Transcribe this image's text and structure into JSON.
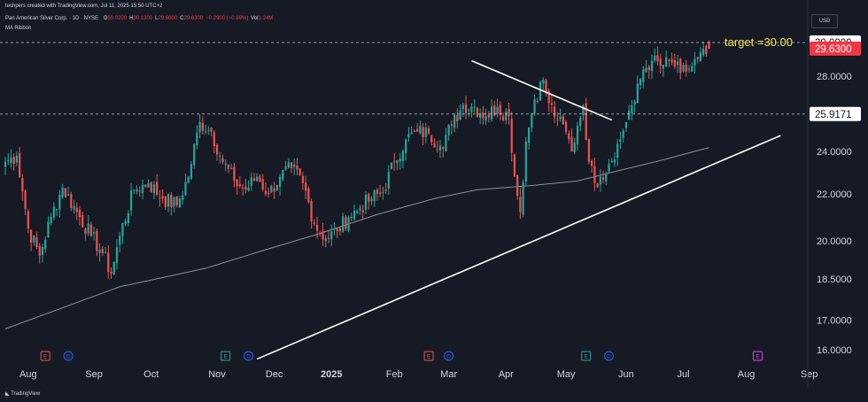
{
  "header": {
    "creator_line": "techpers created with TradingView.com, Jul 11, 2025 15:50 UTC+2",
    "symbol_line": "Pan American Silver Corp. · 1D · NYSE",
    "ohlc": [
      {
        "key": "O",
        "value": "30.0200"
      },
      {
        "key": "H",
        "value": "30.1300"
      },
      {
        "key": "L",
        "value": "29.6000"
      },
      {
        "key": "C",
        "value": "29.6300"
      },
      {
        "key": "",
        "value": "−0.2900 (−0.99%)"
      },
      {
        "key": "Vol",
        "value": "1.24M"
      }
    ],
    "indicator": "MA Ribbon",
    "currency": "USD"
  },
  "annotations": {
    "target_text": "target =30.00"
  },
  "footer": {
    "logo_text": "TradingView"
  },
  "colors": {
    "background": "#161a25",
    "up": "#26a69a",
    "down": "#ef5350",
    "text": "#d1d4dc",
    "target_text": "#f5e642",
    "last_price_label": "#f23645",
    "trendline": "#ffffff",
    "ma": "#b2b5be"
  },
  "chart_data": {
    "type": "candlestick",
    "title": "Pan American Silver Corp. · 1D · NYSE",
    "ylabel": "USD",
    "y_axis_scale": "log",
    "ylim": [
      15.4,
      31.2
    ],
    "y_ticks": [
      "16.0000",
      "17.0000",
      "18.5000",
      "20.0000",
      "22.0000",
      "24.0000",
      "28.0000"
    ],
    "price_labels": [
      {
        "value": "30.0000",
        "style": "white"
      },
      {
        "value": "29.6300",
        "style": "last"
      },
      {
        "value": "25.9171",
        "style": "white"
      }
    ],
    "x_ticks": [
      {
        "label": "Aug",
        "index": 8
      },
      {
        "label": "Sep",
        "index": 31
      },
      {
        "label": "Oct",
        "index": 51
      },
      {
        "label": "Nov",
        "index": 74
      },
      {
        "label": "Dec",
        "index": 94
      },
      {
        "label": "2025",
        "index": 114
      },
      {
        "label": "Feb",
        "index": 136
      },
      {
        "label": "Mar",
        "index": 155
      },
      {
        "label": "Apr",
        "index": 175
      },
      {
        "label": "May",
        "index": 196
      },
      {
        "label": "Jun",
        "index": 217
      },
      {
        "label": "Jul",
        "index": 237
      },
      {
        "label": "Aug",
        "index": 259
      },
      {
        "label": "Sep",
        "index": 281
      }
    ],
    "horizontal_levels": [
      30.0,
      25.9171
    ],
    "event_markers": [
      {
        "index": 14,
        "letter": "E",
        "color": "#ef5350"
      },
      {
        "index": 22,
        "letter": "D",
        "color": "#2962ff"
      },
      {
        "index": 77,
        "letter": "E",
        "color": "#26a69a"
      },
      {
        "index": 85,
        "letter": "D",
        "color": "#2962ff"
      },
      {
        "index": 148,
        "letter": "E",
        "color": "#ef5350"
      },
      {
        "index": 155,
        "letter": "D",
        "color": "#2962ff"
      },
      {
        "index": 203,
        "letter": "E",
        "color": "#26a69a"
      },
      {
        "index": 211,
        "letter": "D",
        "color": "#2962ff"
      },
      {
        "index": 263,
        "letter": "E",
        "color": "#e040fb"
      }
    ],
    "anchors": [
      [
        0,
        23.5
      ],
      [
        4,
        23.8
      ],
      [
        8,
        20.5
      ],
      [
        12,
        19.4
      ],
      [
        16,
        21.0
      ],
      [
        20,
        22.3
      ],
      [
        25,
        21.2
      ],
      [
        30,
        20.2
      ],
      [
        34,
        19.5
      ],
      [
        37,
        18.7
      ],
      [
        40,
        20.2
      ],
      [
        45,
        22.2
      ],
      [
        50,
        22.5
      ],
      [
        55,
        21.8
      ],
      [
        60,
        21.5
      ],
      [
        64,
        22.8
      ],
      [
        68,
        25.5
      ],
      [
        72,
        25.0
      ],
      [
        76,
        23.5
      ],
      [
        80,
        22.6
      ],
      [
        84,
        22.2
      ],
      [
        88,
        22.8
      ],
      [
        92,
        22.0
      ],
      [
        96,
        22.8
      ],
      [
        100,
        23.2
      ],
      [
        104,
        22.5
      ],
      [
        108,
        20.7
      ],
      [
        112,
        20.1
      ],
      [
        116,
        20.4
      ],
      [
        120,
        21.0
      ],
      [
        124,
        21.4
      ],
      [
        128,
        21.8
      ],
      [
        132,
        22.1
      ],
      [
        136,
        23.5
      ],
      [
        140,
        24.6
      ],
      [
        144,
        25.0
      ],
      [
        148,
        24.9
      ],
      [
        152,
        24.3
      ],
      [
        156,
        25.3
      ],
      [
        160,
        26.4
      ],
      [
        164,
        26.3
      ],
      [
        168,
        25.8
      ],
      [
        172,
        26.3
      ],
      [
        176,
        25.8
      ],
      [
        178,
        22.8
      ],
      [
        180,
        21.2
      ],
      [
        182,
        24.5
      ],
      [
        185,
        26.7
      ],
      [
        188,
        27.8
      ],
      [
        190,
        26.5
      ],
      [
        193,
        25.6
      ],
      [
        196,
        25.0
      ],
      [
        198,
        24.0
      ],
      [
        200,
        25.3
      ],
      [
        202,
        26.4
      ],
      [
        204,
        23.5
      ],
      [
        206,
        22.5
      ],
      [
        208,
        22.8
      ],
      [
        211,
        23.4
      ],
      [
        215,
        24.6
      ],
      [
        218,
        26.1
      ],
      [
        220,
        26.6
      ],
      [
        223,
        28.4
      ],
      [
        226,
        28.9
      ],
      [
        229,
        28.6
      ],
      [
        233,
        28.8
      ],
      [
        236,
        28.2
      ],
      [
        239,
        28.4
      ],
      [
        242,
        29.0
      ],
      [
        245,
        29.3
      ],
      [
        246,
        29.63
      ]
    ],
    "last_candle": {
      "open": 30.02,
      "high": 30.13,
      "low": 29.6,
      "close": 29.63,
      "volume": "1.24M"
    },
    "moving_average": [
      [
        0,
        16.7
      ],
      [
        40,
        18.2
      ],
      [
        70,
        18.9
      ],
      [
        90,
        19.6
      ],
      [
        110,
        20.3
      ],
      [
        130,
        21.1
      ],
      [
        150,
        21.8
      ],
      [
        165,
        22.2
      ],
      [
        185,
        22.4
      ],
      [
        200,
        22.6
      ],
      [
        215,
        23.1
      ],
      [
        230,
        23.6
      ],
      [
        246,
        24.2
      ]
    ],
    "trendlines": [
      {
        "from": [
          0,
          16.0
        ],
        "to": [
          0,
          16.0
        ]
      },
      {
        "from": [
          88,
          15.7
        ],
        "to": [
          271,
          24.8
        ]
      },
      {
        "from": [
          163,
          28.9
        ],
        "to": [
          212,
          25.6
        ]
      }
    ]
  }
}
